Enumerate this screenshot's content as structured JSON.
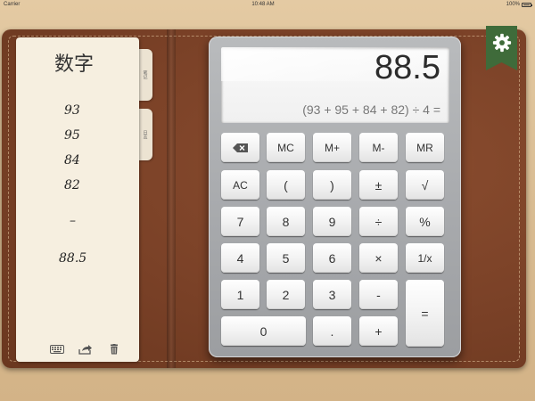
{
  "status_bar": {
    "carrier": "Carrier",
    "time": "10:48 AM",
    "battery": "100%"
  },
  "settings": {
    "icon": "gear-icon",
    "color": "#3f6b3a"
  },
  "notepad": {
    "title": "数字",
    "tabs": [
      "笔记",
      "日志"
    ],
    "lines": [
      "93",
      "95",
      "84",
      "82",
      "–",
      "88.5"
    ],
    "tools": [
      "keyboard-icon",
      "share-icon",
      "trash-icon"
    ]
  },
  "calculator": {
    "display": {
      "result": "88.5",
      "expression": "(93 + 95 + 84 + 82) ÷ 4 ="
    },
    "buttons": {
      "backspace": "⌫",
      "mc": "MC",
      "mplus": "M+",
      "mminus": "M-",
      "mr": "MR",
      "ac": "AC",
      "lparen": "(",
      "rparen": ")",
      "plusminus": "±",
      "sqrt": "√",
      "n7": "7",
      "n8": "8",
      "n9": "9",
      "divide": "÷",
      "percent": "%",
      "n4": "4",
      "n5": "5",
      "n6": "6",
      "multiply": "×",
      "reciprocal": "1/x",
      "n1": "1",
      "n2": "2",
      "n3": "3",
      "minus": "-",
      "equals": "=",
      "n0": "0",
      "dot": ".",
      "plus": "+"
    }
  }
}
